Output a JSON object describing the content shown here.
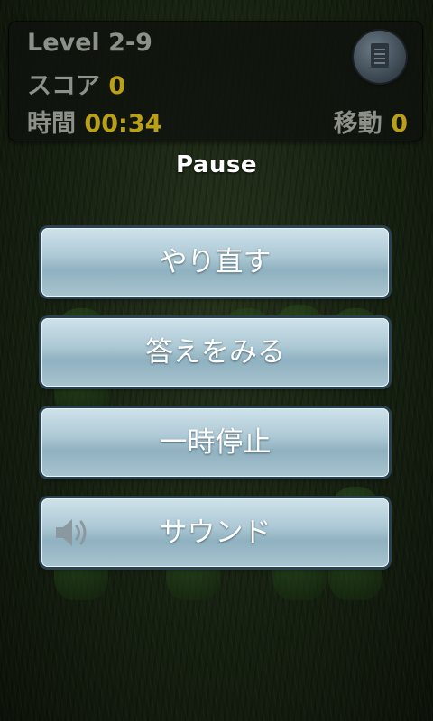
{
  "hud": {
    "level_label": "Level 2-9",
    "score_label": "スコア",
    "score_value": "0",
    "time_label": "時間",
    "time_value": "00:34",
    "moves_label": "移動",
    "moves_value": "0",
    "menu_icon": "menu-sheet-icon"
  },
  "pause": {
    "title": "Pause",
    "buttons": [
      {
        "label": "やり直す"
      },
      {
        "label": "答えをみる"
      },
      {
        "label": "一時停止"
      },
      {
        "label": "サウンド",
        "icon": "speaker-icon"
      }
    ]
  },
  "colors": {
    "hud_value": "#b9a016",
    "hud_label": "#8d918a",
    "button_border": "#2a4150"
  }
}
